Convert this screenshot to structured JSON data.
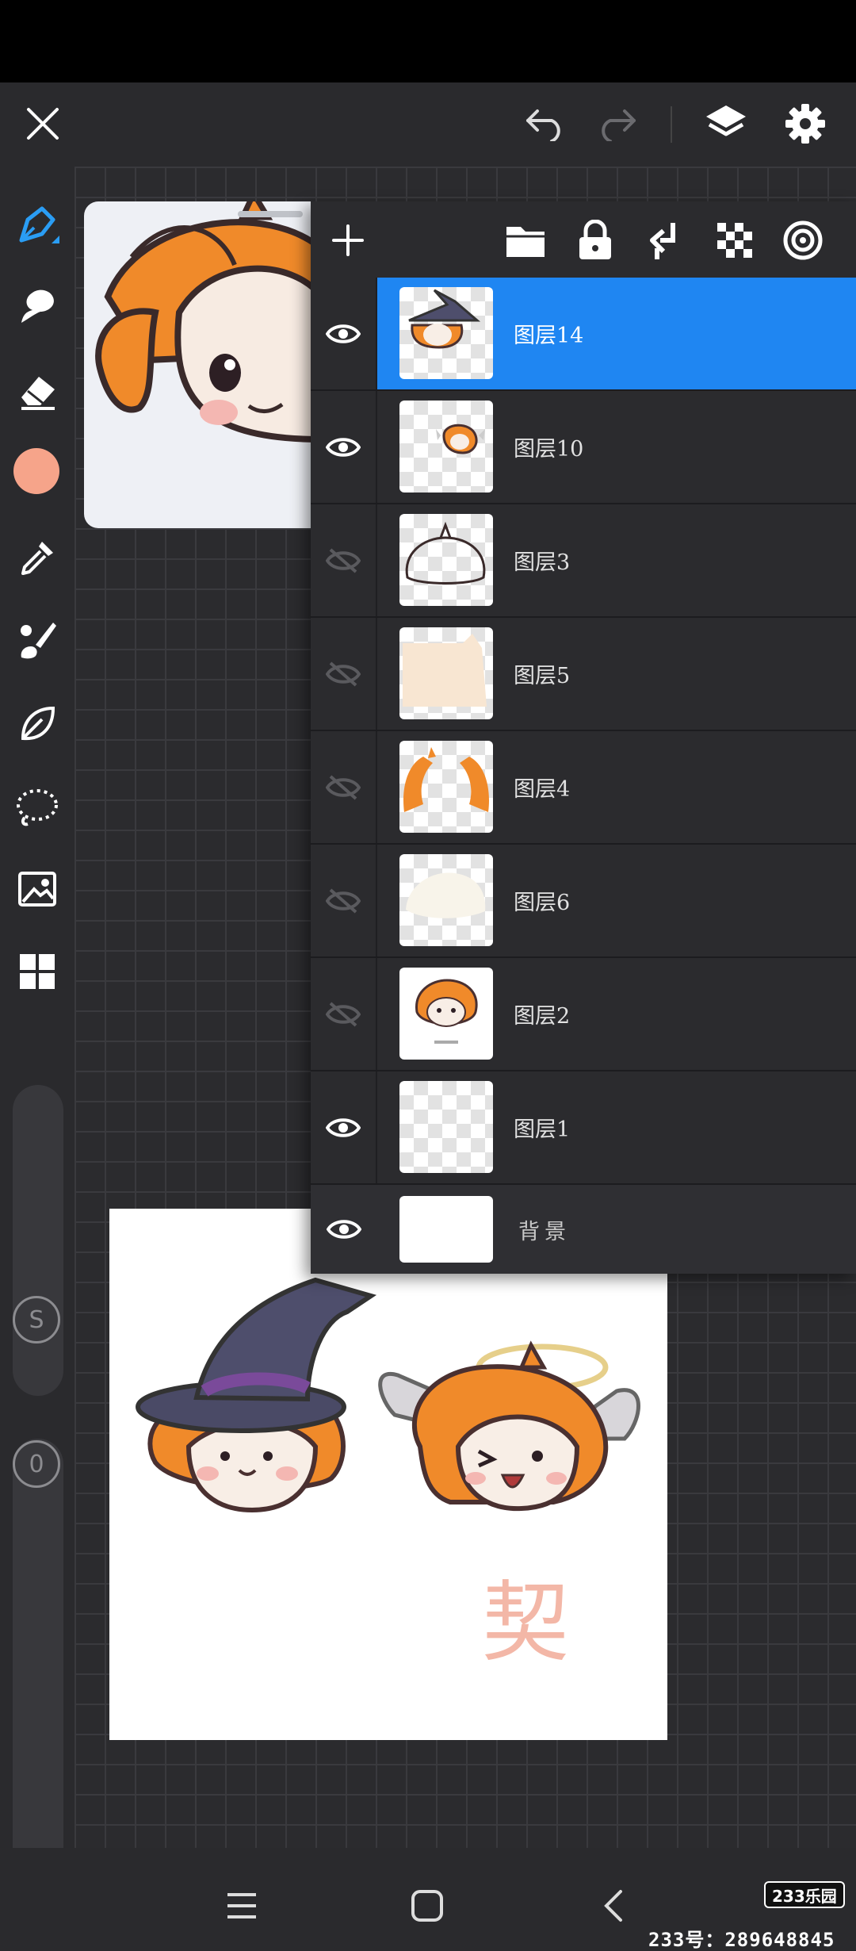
{
  "toolbar": {
    "close_icon": "close-icon",
    "undo_icon": "undo-icon",
    "redo_icon": "redo-icon",
    "layers_icon": "layers-icon",
    "settings_icon": "gear-icon"
  },
  "tools": [
    {
      "name": "pen-tool",
      "icon": "pen-icon",
      "active": true
    },
    {
      "name": "smudge-tool",
      "icon": "smudge-icon"
    },
    {
      "name": "eraser-tool",
      "icon": "eraser-icon"
    },
    {
      "name": "color-swatch",
      "icon": "color-circle",
      "color": "#f6a48a"
    },
    {
      "name": "eyedropper-tool",
      "icon": "eyedropper-icon"
    },
    {
      "name": "brush-tool",
      "icon": "brush-icon"
    },
    {
      "name": "fill-tool",
      "icon": "leaf-icon"
    },
    {
      "name": "lasso-tool",
      "icon": "lasso-icon"
    },
    {
      "name": "image-tool",
      "icon": "image-icon"
    },
    {
      "name": "grid-tool",
      "icon": "grid-icon"
    }
  ],
  "sliders": {
    "size_label": "S",
    "opacity_label": "0"
  },
  "layers_panel": {
    "toolbar_icons": [
      "add-icon",
      "folder-icon",
      "lock-icon",
      "merge-down-icon",
      "checker-icon",
      "target-icon"
    ],
    "layers": [
      {
        "name": "图层14",
        "visible": true,
        "selected": true
      },
      {
        "name": "图层10",
        "visible": true
      },
      {
        "name": "图层3",
        "visible": false
      },
      {
        "name": "图层5",
        "visible": false
      },
      {
        "name": "图层4",
        "visible": false
      },
      {
        "name": "图层6",
        "visible": false
      },
      {
        "name": "图层2",
        "visible": false
      },
      {
        "name": "图层1",
        "visible": true
      },
      {
        "name": "背景",
        "visible": true
      }
    ]
  },
  "canvas": {
    "signature_text": "契"
  },
  "watermark": {
    "brand": "233乐园",
    "id_text": "233号：289648845"
  },
  "colors": {
    "accent": "#1f86f2",
    "tool_active": "#2a9df4",
    "swatch": "#f6a48a"
  }
}
